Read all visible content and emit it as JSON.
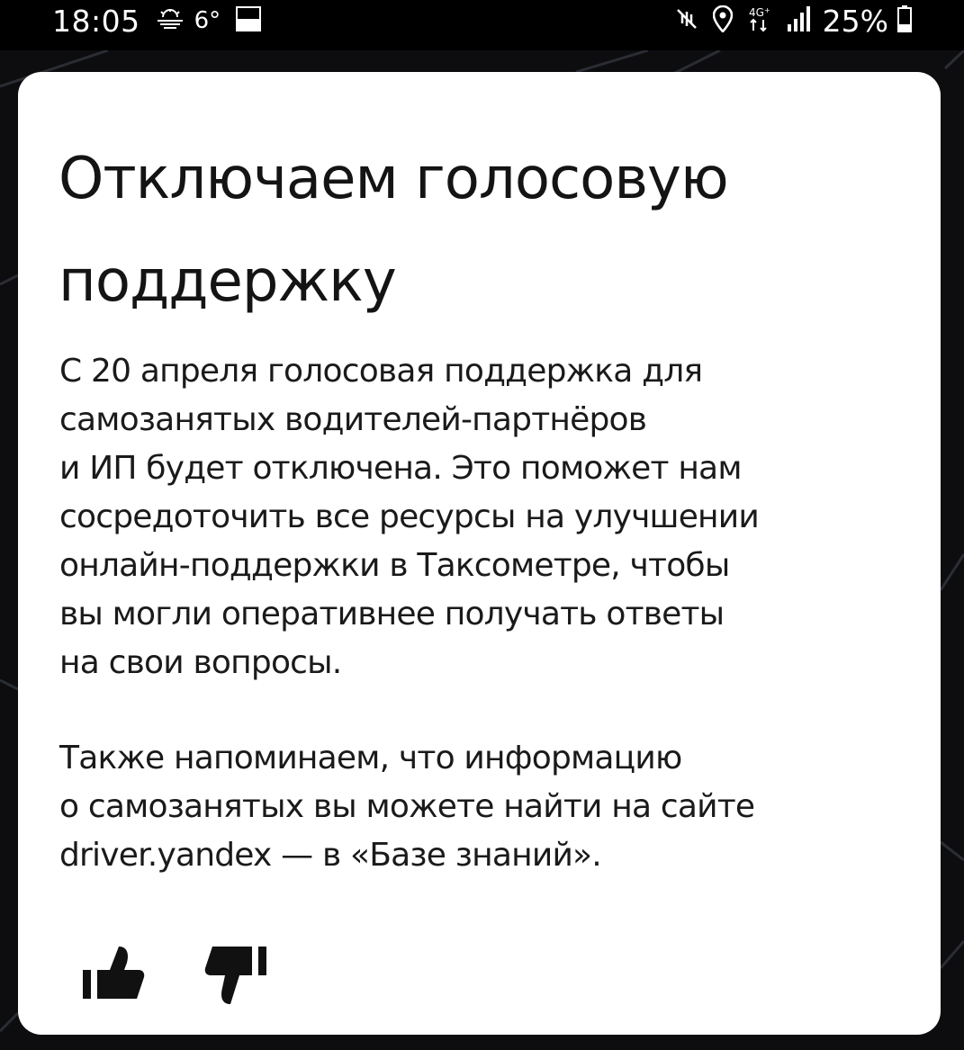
{
  "status_bar": {
    "time": "18:05",
    "temperature": "6°",
    "battery": "25%",
    "icons": [
      "weather-cloud-icon",
      "notification-icon",
      "mute-vibrate-icon",
      "location-icon",
      "network-4g-icon",
      "signal-icon",
      "battery-icon"
    ]
  },
  "card": {
    "title": "Отключаем голосовую поддержку",
    "paragraph_1": "С 20 апреля голосовая поддержка для\nсамозанятых водителей-партнёров\nи ИП будет отключена. Это поможет нам\nсосредоточить все ресурсы на улучшении\nонлайн-поддержки в Таксометре, чтобы\nвы могли оперативнее получать ответы\nна свои вопросы.",
    "paragraph_2": "Также напоминаем, что информацию\nо самозанятых вы можете найти на сайте\ndriver.yandex — в «Базе знаний».",
    "feedback": {
      "like_icon": "thumbs-up-icon",
      "dislike_icon": "thumbs-down-icon"
    }
  },
  "colors": {
    "background": "#0d0d0f",
    "card": "#ffffff",
    "text": "#141414"
  }
}
